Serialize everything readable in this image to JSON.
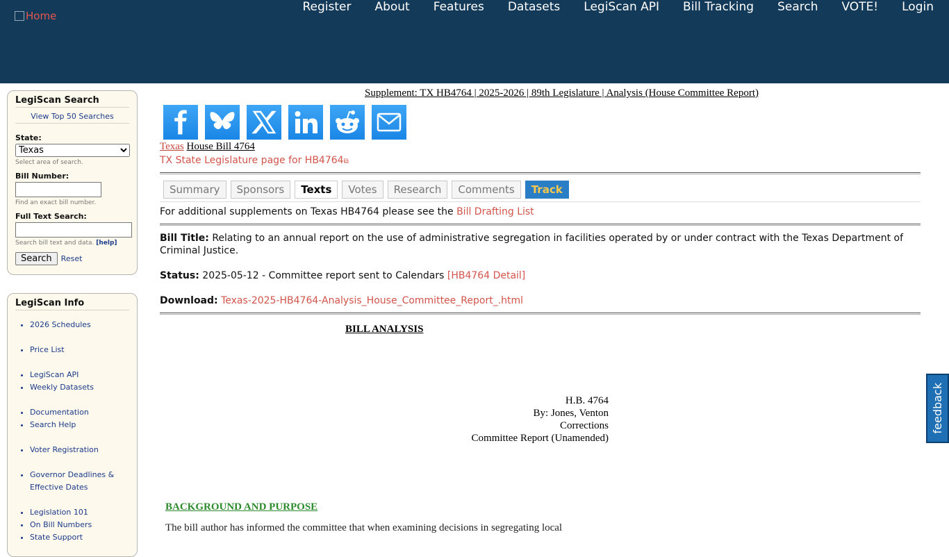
{
  "header": {
    "home_alt": "Home",
    "nav": [
      "Register",
      "About",
      "Features",
      "Datasets",
      "LegiScan API",
      "Bill Tracking",
      "Search",
      "VOTE!",
      "Login"
    ]
  },
  "search_box": {
    "title": "LegiScan Search",
    "top50": "View Top 50 Searches",
    "state_label": "State:",
    "state_value": "Texas",
    "state_hint": "Select area of search.",
    "bill_label": "Bill Number:",
    "bill_hint": "Find an exact bill number.",
    "full_label": "Full Text Search:",
    "full_hint": "Search bill text and data.",
    "help_link": "[help]",
    "search_button": "Search",
    "reset": "Reset"
  },
  "info_box": {
    "title": "LegiScan Info",
    "items": [
      "2026 Schedules",
      "Price List",
      "LegiScan API",
      "Weekly Datasets",
      "Documentation",
      "Search Help",
      "Voter Registration",
      "Governor Deadlines & Effective Dates",
      "Legislation 101",
      "On Bill Numbers",
      "State Support"
    ]
  },
  "main": {
    "supplement": "Supplement: TX HB4764 | 2025-2026 | 89th Legislature | Analysis (House Committee Report)",
    "share_icons": [
      "facebook-icon",
      "bluesky-icon",
      "x-icon",
      "linkedin-icon",
      "reddit-icon",
      "email-icon"
    ],
    "state_link": "Texas",
    "bill_name": "House Bill 4764",
    "tx_link": "TX State Legislature page for HB4764",
    "tabs": [
      "Summary",
      "Sponsors",
      "Texts",
      "Votes",
      "Research",
      "Comments",
      "Track"
    ],
    "supp_prefix": "For additional supplements on Texas HB4764 please see the",
    "supp_link": "Bill Drafting List",
    "title_label": "Bill Title:",
    "title_text": "Relating to an annual report on the use of administrative segregation in facilities operated by or under contract with the Texas Department of Criminal Justice.",
    "status_label": "Status:",
    "status_text": "2025-05-12 - Committee report sent to Calendars",
    "status_link": "[HB4764 Detail]",
    "download_label": "Download:",
    "download_link": "Texas-2025-HB4764-Analysis_House_Committee_Report_.html"
  },
  "doc": {
    "heading": "BILL ANALYSIS",
    "meta": [
      "H.B. 4764",
      "By: Jones, Venton",
      "Corrections",
      "Committee Report (Unamended)"
    ],
    "section": "BACKGROUND AND PURPOSE",
    "cut_line": "The bill author has informed the committee that when examining decisions in segregating local"
  },
  "feedback": "feedback"
}
